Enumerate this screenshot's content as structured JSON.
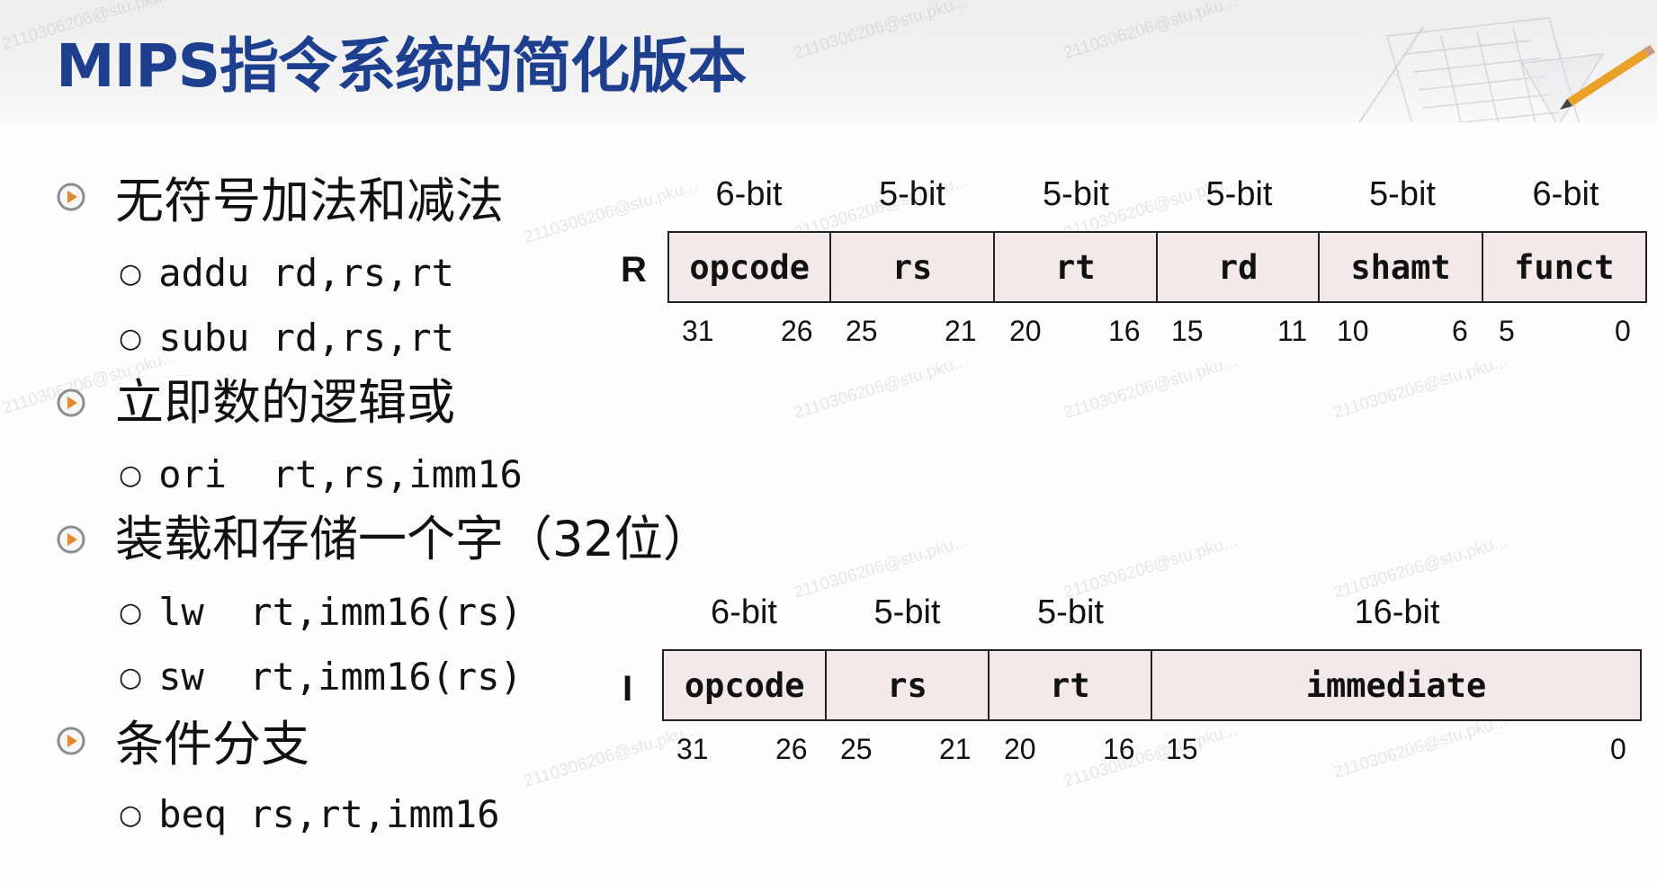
{
  "slide": {
    "title": "MIPS指令系统的简化版本",
    "watermark": "2110306206@stu.pku...",
    "accent_color": "#1d3f8e",
    "field_fill_color": "#f3e9e9"
  },
  "sections": [
    {
      "heading": "无符号加法和减法",
      "items": [
        "addu rd,rs,rt",
        "subu rd,rs,rt"
      ]
    },
    {
      "heading": "立即数的逻辑或",
      "items": [
        "ori  rt,rs,imm16"
      ]
    },
    {
      "heading": "装载和存储一个字（32位）",
      "items": [
        "lw  rt,imm16(rs)",
        "sw  rt,imm16(rs)"
      ]
    },
    {
      "heading": "条件分支",
      "items": [
        "beq rs,rt,imm16"
      ]
    }
  ],
  "formats": {
    "r": {
      "letter": "R",
      "fields": [
        {
          "name": "opcode",
          "bits": "6-bit",
          "hi": "31",
          "lo": "26"
        },
        {
          "name": "rs",
          "bits": "5-bit",
          "hi": "25",
          "lo": "21"
        },
        {
          "name": "rt",
          "bits": "5-bit",
          "hi": "20",
          "lo": "16"
        },
        {
          "name": "rd",
          "bits": "5-bit",
          "hi": "15",
          "lo": "11"
        },
        {
          "name": "shamt",
          "bits": "5-bit",
          "hi": "10",
          "lo": "6"
        },
        {
          "name": "funct",
          "bits": "6-bit",
          "hi": "5",
          "lo": "0"
        }
      ]
    },
    "i": {
      "letter": "I",
      "fields": [
        {
          "name": "opcode",
          "bits": "6-bit",
          "hi": "31",
          "lo": "26"
        },
        {
          "name": "rs",
          "bits": "5-bit",
          "hi": "25",
          "lo": "21"
        },
        {
          "name": "rt",
          "bits": "5-bit",
          "hi": "20",
          "lo": "16"
        },
        {
          "name": "immediate",
          "bits": "16-bit",
          "hi": "15",
          "lo": "0"
        }
      ]
    }
  }
}
